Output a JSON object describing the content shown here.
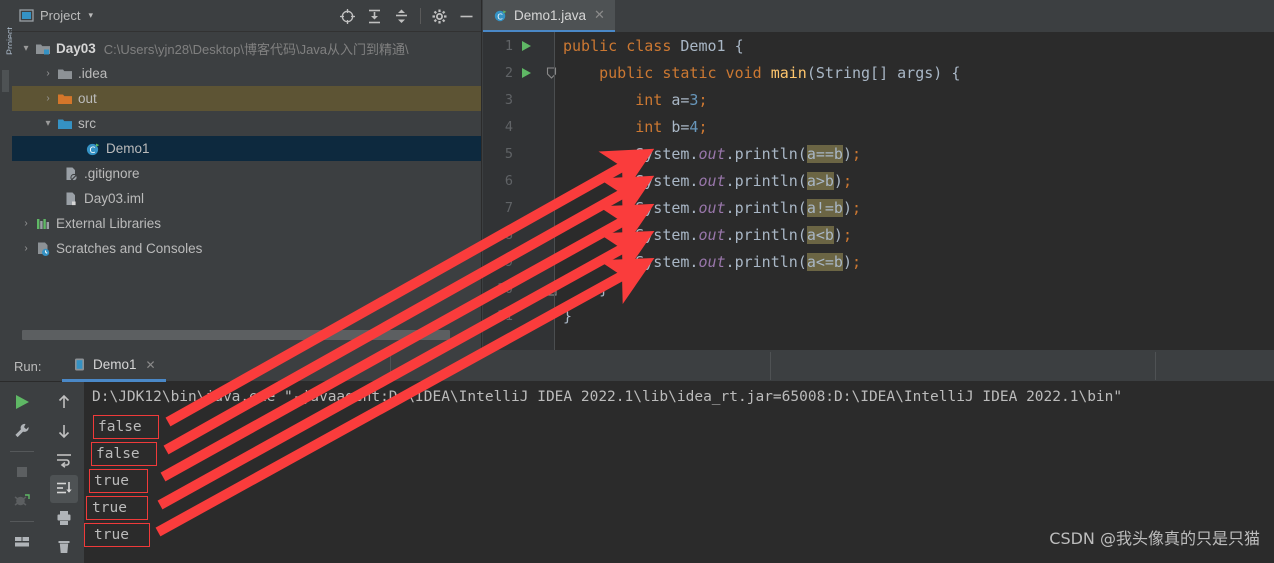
{
  "left_strip": {
    "label": "Project",
    "icon": "tool-window-stripe"
  },
  "project_panel": {
    "title": "Project",
    "chevron": "▾",
    "window_icon": "project-window-icon",
    "tools": [
      {
        "name": "locate-icon",
        "glyph": "locate"
      },
      {
        "name": "expand-all-icon",
        "glyph": "expand"
      },
      {
        "name": "collapse-all-icon",
        "glyph": "collapse"
      },
      {
        "name": "settings-gear-icon",
        "glyph": "gear"
      },
      {
        "name": "hide-panel-icon",
        "glyph": "minus"
      }
    ],
    "tree": [
      {
        "arrow": "▾",
        "icon": "module-folder-icon",
        "label": "Day03",
        "bold": true,
        "path": "C:\\Users\\yjn28\\Desktop\\博客代码\\Java从入门到精通\\",
        "indent": 0,
        "state": "none"
      },
      {
        "arrow": "›",
        "icon": "folder-grey-icon",
        "label": ".idea",
        "bold": false,
        "path": "",
        "indent": 1,
        "state": "none"
      },
      {
        "arrow": "›",
        "icon": "folder-orange-icon",
        "label": "out",
        "bold": false,
        "path": "",
        "indent": 1,
        "state": "out"
      },
      {
        "arrow": "▾",
        "icon": "folder-source-icon",
        "label": "src",
        "bold": false,
        "path": "",
        "indent": 1,
        "state": "none"
      },
      {
        "arrow": "",
        "icon": "java-class-icon",
        "label": "Demo1",
        "bold": false,
        "path": "",
        "indent": 3,
        "state": "demo"
      },
      {
        "arrow": "",
        "icon": "gitignore-file-icon",
        "label": ".gitignore",
        "bold": false,
        "path": "",
        "indent": 2,
        "state": "none"
      },
      {
        "arrow": "",
        "icon": "iml-file-icon",
        "label": "Day03.iml",
        "bold": false,
        "path": "",
        "indent": 2,
        "state": "none"
      },
      {
        "arrow": "›",
        "icon": "external-libraries-icon",
        "label": "External Libraries",
        "bold": false,
        "path": "",
        "indent": 0,
        "state": "none"
      },
      {
        "arrow": "›",
        "icon": "scratches-icon",
        "label": "Scratches and Consoles",
        "bold": false,
        "path": "",
        "indent": 0,
        "state": "none"
      }
    ]
  },
  "editor": {
    "tab": {
      "label": "Demo1.java",
      "icon": "java-class-icon",
      "close": "✕"
    },
    "line_numbers": [
      "1",
      "2",
      "3",
      "4",
      "5",
      "6",
      "7",
      "8",
      "9",
      "10",
      "11"
    ],
    "lines": [
      {
        "n": 1,
        "indent": 0,
        "tokens": [
          {
            "t": "public",
            "c": "kw"
          },
          {
            "t": " ",
            "c": "punc"
          },
          {
            "t": "class",
            "c": "kw"
          },
          {
            "t": " ",
            "c": "punc"
          },
          {
            "t": "Demo1",
            "c": "cls"
          },
          {
            "t": " {",
            "c": "punc"
          }
        ]
      },
      {
        "n": 2,
        "indent": 1,
        "tokens": [
          {
            "t": "public",
            "c": "kw"
          },
          {
            "t": " ",
            "c": "punc"
          },
          {
            "t": "static",
            "c": "kw"
          },
          {
            "t": " ",
            "c": "punc"
          },
          {
            "t": "void",
            "c": "kw"
          },
          {
            "t": " ",
            "c": "punc"
          },
          {
            "t": "main",
            "c": "method"
          },
          {
            "t": "(",
            "c": "punc"
          },
          {
            "t": "String[] args",
            "c": "ident"
          },
          {
            "t": ") {",
            "c": "punc"
          }
        ]
      },
      {
        "n": 3,
        "indent": 2,
        "tokens": [
          {
            "t": "int",
            "c": "kw"
          },
          {
            "t": " ",
            "c": "punc"
          },
          {
            "t": "a=",
            "c": "ident"
          },
          {
            "t": "3",
            "c": "num"
          },
          {
            "t": ";",
            "c": "semi"
          }
        ]
      },
      {
        "n": 4,
        "indent": 2,
        "tokens": [
          {
            "t": "int",
            "c": "kw"
          },
          {
            "t": " ",
            "c": "punc"
          },
          {
            "t": "b=",
            "c": "ident"
          },
          {
            "t": "4",
            "c": "num"
          },
          {
            "t": ";",
            "c": "semi"
          }
        ]
      },
      {
        "n": 5,
        "indent": 2,
        "tokens": [
          {
            "t": "System",
            "c": "cls"
          },
          {
            "t": ".",
            "c": "punc"
          },
          {
            "t": "out",
            "c": "field-static"
          },
          {
            "t": ".",
            "c": "punc"
          },
          {
            "t": "println",
            "c": "ident"
          },
          {
            "t": "(",
            "c": "punc"
          },
          {
            "t": "a==b",
            "c": "ident hl"
          },
          {
            "t": ")",
            "c": "punc"
          },
          {
            "t": ";",
            "c": "semi"
          }
        ]
      },
      {
        "n": 6,
        "indent": 2,
        "tokens": [
          {
            "t": "System",
            "c": "cls"
          },
          {
            "t": ".",
            "c": "punc"
          },
          {
            "t": "out",
            "c": "field-static"
          },
          {
            "t": ".",
            "c": "punc"
          },
          {
            "t": "println",
            "c": "ident"
          },
          {
            "t": "(",
            "c": "punc"
          },
          {
            "t": "a>b",
            "c": "ident hl"
          },
          {
            "t": ")",
            "c": "punc"
          },
          {
            "t": ";",
            "c": "semi"
          }
        ]
      },
      {
        "n": 7,
        "indent": 2,
        "tokens": [
          {
            "t": "System",
            "c": "cls"
          },
          {
            "t": ".",
            "c": "punc"
          },
          {
            "t": "out",
            "c": "field-static"
          },
          {
            "t": ".",
            "c": "punc"
          },
          {
            "t": "println",
            "c": "ident"
          },
          {
            "t": "(",
            "c": "punc"
          },
          {
            "t": "a!=b",
            "c": "ident hl"
          },
          {
            "t": ")",
            "c": "punc"
          },
          {
            "t": ";",
            "c": "semi"
          }
        ]
      },
      {
        "n": 8,
        "indent": 2,
        "tokens": [
          {
            "t": "System",
            "c": "cls"
          },
          {
            "t": ".",
            "c": "punc"
          },
          {
            "t": "out",
            "c": "field-static"
          },
          {
            "t": ".",
            "c": "punc"
          },
          {
            "t": "println",
            "c": "ident"
          },
          {
            "t": "(",
            "c": "punc"
          },
          {
            "t": "a<b",
            "c": "ident hl"
          },
          {
            "t": ")",
            "c": "punc"
          },
          {
            "t": ";",
            "c": "semi"
          }
        ]
      },
      {
        "n": 9,
        "indent": 2,
        "tokens": [
          {
            "t": "System",
            "c": "cls"
          },
          {
            "t": ".",
            "c": "punc"
          },
          {
            "t": "out",
            "c": "field-static"
          },
          {
            "t": ".",
            "c": "punc"
          },
          {
            "t": "println",
            "c": "ident"
          },
          {
            "t": "(",
            "c": "punc"
          },
          {
            "t": "a<=b",
            "c": "ident hl"
          },
          {
            "t": ")",
            "c": "punc"
          },
          {
            "t": ";",
            "c": "semi"
          }
        ]
      },
      {
        "n": 10,
        "indent": 1,
        "tokens": [
          {
            "t": "}",
            "c": "punc"
          }
        ]
      },
      {
        "n": 11,
        "indent": 0,
        "tokens": [
          {
            "t": "}",
            "c": "punc"
          }
        ]
      }
    ]
  },
  "run_panel": {
    "label": "Run:",
    "tab": {
      "label": "Demo1",
      "icon": "run-config-icon",
      "close": "✕"
    },
    "toolbar_left": [
      {
        "name": "rerun-button",
        "icon": "play-green-icon"
      },
      {
        "name": "edit-configurations-button",
        "icon": "wrench-icon"
      },
      {
        "name": "stop-button",
        "icon": "stop-square-icon"
      },
      {
        "name": "rerun-failed-button",
        "icon": "debug-rerun-icon"
      },
      {
        "name": "layout-settings-button",
        "icon": "layout-icon"
      }
    ],
    "toolbar_right": [
      {
        "name": "up-button",
        "icon": "arrow-up-icon"
      },
      {
        "name": "down-button",
        "icon": "arrow-down-icon"
      },
      {
        "name": "soft-wrap-button",
        "icon": "soft-wrap-icon"
      },
      {
        "name": "scroll-to-end-button",
        "icon": "scroll-end-icon",
        "active": true
      },
      {
        "name": "print-button",
        "icon": "printer-icon"
      },
      {
        "name": "clear-all-button",
        "icon": "trash-icon"
      }
    ],
    "console": {
      "command": "D:\\JDK12\\bin\\java.exe \"-javaagent:D:\\IDEA\\IntelliJ IDEA 2022.1\\lib\\idea_rt.jar=65008:D:\\IDEA\\IntelliJ IDEA 2022.1\\bin\"",
      "outputs": [
        "false",
        "false",
        "true",
        "true",
        "true"
      ]
    }
  },
  "annotations": {
    "box_color": "#f03a3a",
    "arrow_color": "#fa3c3c",
    "count": 5
  },
  "watermark": "CSDN @我头像真的只是只猫"
}
